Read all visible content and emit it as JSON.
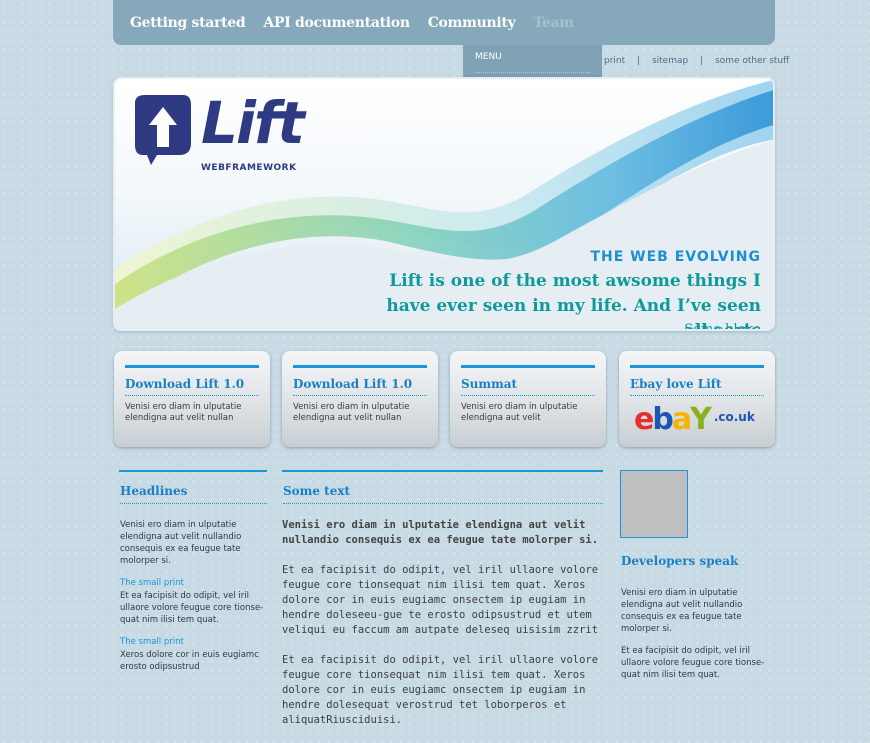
{
  "nav": {
    "items": [
      "Getting started",
      "API documentation",
      "Community",
      "Team"
    ],
    "dropdown_title": "MENU"
  },
  "util_nav": {
    "links": [
      "print",
      "sitemap",
      "some other stuff"
    ],
    "separator": "|"
  },
  "hero": {
    "logo_word": "Lift",
    "logo_sub": "WEBFRAMEWORK",
    "heading": "THE WEB EVOLVING",
    "quote": "Lift is one of the most awsome things I have ever seen in my life. And I’ve seen all sorts",
    "author": "Some bloke"
  },
  "boxes": [
    {
      "title": "Download Lift 1.0",
      "text": "Venisi ero diam in ulputatie elendigna aut velit nullan"
    },
    {
      "title": "Download Lift 1.0",
      "text": "Venisi ero diam in ulputatie elendigna aut velit nullan"
    },
    {
      "title": "Summat",
      "text": "Venisi ero diam in ulputatie elendigna aut velit"
    },
    {
      "title": "Ebay love Lift",
      "ebay": {
        "e": "e",
        "b": "b",
        "a": "a",
        "y": "Y",
        "suffix": ".co.uk"
      }
    }
  ],
  "headlines": {
    "title": "Headlines",
    "intro": "Venisi ero diam in ulputatie elendigna aut velit nullandio consequis ex ea feugue tate molorper si.",
    "items": [
      {
        "link": "The small print",
        "text": "Et ea facipisit do odipit, vel iril ullaore volore feugue core tionse-quat nim ilisi tem quat."
      },
      {
        "link": "The small print",
        "text": "Xeros dolore cor in euis eugiamc erosto odipsustrud"
      }
    ]
  },
  "some_text": {
    "title": "Some text",
    "lead": "Venisi ero diam in ulputatie elendigna aut velit nullandio consequis ex ea feugue tate molorper si.",
    "p1": "Et ea facipisit do odipit, vel iril ullaore volore feugue core tionsequat nim ilisi tem quat. Xeros dolore cor in euis eugiamc onsectem ip eugiam in hendre doleseeu-gue te erosto odipsustrud et utem veliqui eu faccum am autpate deleseq uisisim zzrit",
    "p2": "Et ea facipisit do odipit, vel iril ullaore volore feugue core tionsequat nim ilisi tem quat. Xeros dolore cor in euis eugiamc onsectem ip eugiam in hendre dolesequat verostrud tet loborperos et aliquatRiusciduisi."
  },
  "developers": {
    "title": "Developers speak",
    "p1": "Venisi ero diam in ulputatie elendigna aut velit nullandio consequis ex ea feugue tate molorper si.",
    "p2": "Et ea facipisit do odipit, vel iril ullaore volore feugue core tionse-quat nim ilisi tem quat."
  },
  "colors": {
    "accent": "#1a95d8",
    "nav_bg": "#86a8bb",
    "quote": "#0e9a9d",
    "logo": "#2e3a82"
  }
}
